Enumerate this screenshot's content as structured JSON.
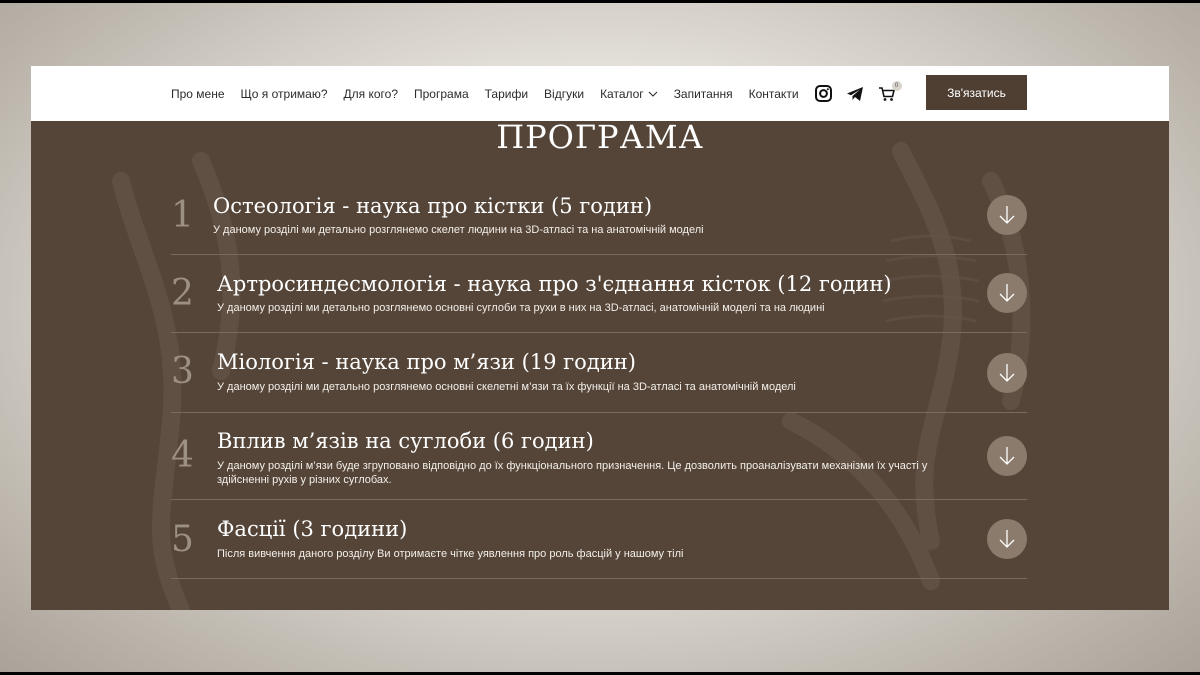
{
  "nav": {
    "items": [
      {
        "label": "Про мене"
      },
      {
        "label": "Що я отримаю?"
      },
      {
        "label": "Для кого?"
      },
      {
        "label": "Програма"
      },
      {
        "label": "Тарифи"
      },
      {
        "label": "Відгуки"
      },
      {
        "label": "Каталог"
      },
      {
        "label": "Запитання"
      },
      {
        "label": "Контакти"
      }
    ],
    "icons": [
      "instagram-icon",
      "telegram-icon",
      "cart-icon",
      "chevron-down-icon"
    ],
    "cart_count": "0",
    "contact_button": "Зв'язатись"
  },
  "section": {
    "title": "ПРОГРАМА"
  },
  "program": [
    {
      "number": "1",
      "title": "Остеологія - наука про кістки (5 годин)",
      "description": "У даному розділі ми детально розглянемо скелет людини на 3D-атласі та на анатомічній моделі"
    },
    {
      "number": "2",
      "title": "Артросиндесмологія - наука про з'єднання кісток (12 годин)",
      "description": "У даному розділі ми детально розглянемо основні суглоби та рухи в них на 3D-атласі, анатомічній моделі та на людині"
    },
    {
      "number": "3",
      "title": "Міологія - наука про м’язи (19 годин)",
      "description": "У даному розділі ми детально розглянемо основні скелетні м’язи та їх функції на 3D-атласі та анатомічній моделі"
    },
    {
      "number": "4",
      "title": "Вплив м’язів на суглоби (6 годин)",
      "description": "У даному розділі м’язи буде згруповано відповідно до їх функціонального призначення. Це дозволить проаналізувати механізми їх участі у здійсненні рухів у різних суглобах."
    },
    {
      "number": "5",
      "title": "Фасції (3 години)",
      "description": "Після вивчення даного розділу Ви отримаєте чітке уявлення про роль фасцій у нашому тілі"
    }
  ],
  "colors": {
    "section_bg": "#554538",
    "header_bg": "#ffffff",
    "button_bg": "#4f3f33",
    "toggle_bg": "#8b7b6c",
    "number_color": "#9c8f83"
  }
}
